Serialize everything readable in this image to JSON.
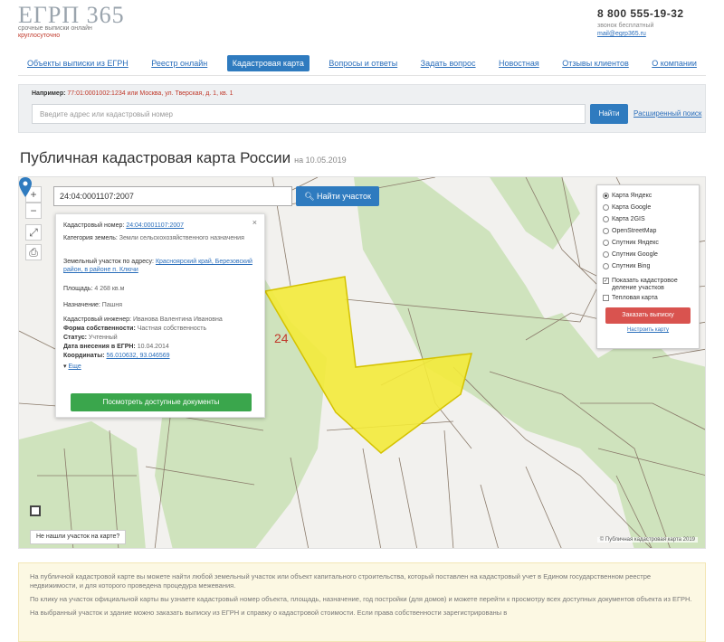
{
  "header": {
    "logo": "ЕГРП 365",
    "tagline_line1": "срочные выписки онлайн",
    "tagline_line2": "круглосуточно",
    "phone": "8 800 555-19-32",
    "phone_note": "звонок бесплатный",
    "email": "mail@egrp365.ru"
  },
  "nav": {
    "items": [
      "Объекты выписки из ЕГРН",
      "Реестр онлайн",
      "Кадастровая карта",
      "Вопросы и ответы",
      "Задать вопрос",
      "Новостная",
      "Отзывы клиентов",
      "О компании"
    ],
    "active_index": 2
  },
  "search": {
    "hint_label": "Например:",
    "hint_text": "77:01:0001002:1234 или Москва, ул. Тверская, д. 1, кв. 1",
    "placeholder": "Введите адрес или кадастровый номер",
    "find_label": "Найти",
    "advanced_label": "Расширенный поиск"
  },
  "page": {
    "title": "Публичная кадастровая карта России",
    "date": "на 10.05.2019"
  },
  "map": {
    "cadastral_input": "24:04:0001107:2007",
    "find_plot_label": "Найти участок",
    "zone_label": "24",
    "where_label": "Не нашли участок на карте?",
    "attribution": "© Публичная кадастровая карта 2019",
    "popup": {
      "cad_number_label": "Кадастровый номер:",
      "cad_number_value": "24:04:0001107:2007",
      "category_label": "Категория земель:",
      "category_value": "Земли сельскохозяйственного назначения",
      "address_label": "Земельный участок по адресу:",
      "address_value": "Красноярский край, Березовский район, в районе п. Ключи",
      "area_label": "Площадь:",
      "area_value": "4 268 кв.м",
      "name_label": "Назначение:",
      "name_value": "Пашня",
      "engineer_label": "Кадастровый инженер:",
      "engineer_value": "Иванова Валентина Ивановна",
      "ownership_label": "Форма собственности:",
      "ownership_value": "Частная собственность",
      "status_label": "Статус:",
      "status_value": "Учтенный",
      "date_label": "Дата внесения в ЕГРН:",
      "date_value": "10.04.2014",
      "coords_label": "Координаты:",
      "coords_value": "56.010632, 93.046569",
      "more_label": "Еще",
      "order_label": "Посмотреть доступные документы"
    },
    "layers": {
      "base": [
        "Карта Яндекс",
        "Карта Google",
        "Карта 2GIS",
        "OpenStreetMap",
        "Спутник Яндекс",
        "Спутник Google",
        "Спутник Bing"
      ],
      "selected_index": 0,
      "option1": "Показать кадастровое деление участков",
      "option1_checked": true,
      "option2": "Тепловая карта",
      "option2_checked": false,
      "order_btn": "Заказать выписку",
      "setup_link": "Настроить карту"
    }
  },
  "notice": {
    "p1": "На публичной кадастровой карте вы можете найти любой земельный участок или объект капитального строительства, который поставлен на кадастровый учет в Едином государственном реестре недвижимости, и для которого проведена процедура межевания.",
    "p2": "По клику на участок официальной карты вы узнаете кадастровый номер объекта, площадь, назначение, год постройки (для домов) и можете перейти к просмотру всех доступных документов объекта из ЕГРН.",
    "p3": "На выбранный участок и здание можно заказать выписку из ЕГРН и справку о кадастровой стоимости. Если права собственности зарегистрированы в"
  }
}
